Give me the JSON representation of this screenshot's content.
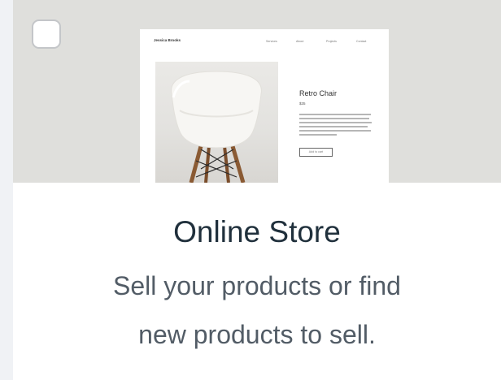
{
  "card": {
    "title": "Online Store",
    "description_line1": "Sell your products or find",
    "description_line2": "new products to sell.",
    "checkbox_checked": false
  },
  "preview": {
    "brand": "Jessica Brooks",
    "nav": [
      "Services",
      "About",
      "Projects",
      "Contact"
    ],
    "product_title": "Retro Chair",
    "product_price": "$35",
    "button_label": "Add to cart"
  },
  "colors": {
    "preview_background": "#dfdfdc",
    "title_text": "#20303c",
    "description_text": "#525c66",
    "page_edge": "#f0f2f5"
  }
}
